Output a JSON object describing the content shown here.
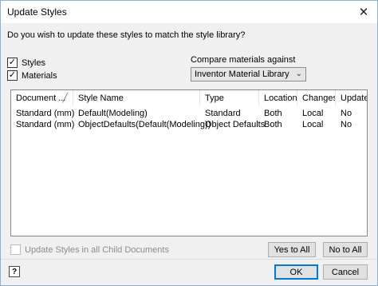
{
  "window": {
    "title": "Update Styles",
    "close_glyph": "✕"
  },
  "question": "Do you wish to update these styles to match the style library?",
  "checkboxes": {
    "styles": {
      "label": "Styles",
      "checked": true
    },
    "materials": {
      "label": "Materials",
      "checked": true
    }
  },
  "compare": {
    "label": "Compare materials against",
    "selected": "Inventor Material Library"
  },
  "table": {
    "columns": [
      "Document ...",
      "Style Name",
      "Type",
      "Location",
      "Changes",
      "Update?"
    ],
    "sort_glyph": "╱",
    "rows": [
      [
        "Standard (mm)",
        "Default(Modeling)",
        "Standard",
        "Both",
        "Local",
        "No"
      ],
      [
        "Standard (mm)",
        "ObjectDefaults(Default(Modeling))",
        "Object Defaults",
        "Both",
        "Local",
        "No"
      ]
    ]
  },
  "child_documents": {
    "label": "Update Styles in all Child Documents",
    "checked": false,
    "enabled": false
  },
  "buttons": {
    "yes_to_all": "Yes to All",
    "no_to_all": "No to All",
    "ok": "OK",
    "cancel": "Cancel",
    "help": "?"
  },
  "colors": {
    "accent": "#0078d7",
    "window_border": "#8ab0d8",
    "dialog_bg": "#f0f0f0"
  },
  "icons": {
    "close": "close-icon",
    "help": "help-icon",
    "dropdown": "chevron-down-icon",
    "check": "checkmark-icon"
  }
}
